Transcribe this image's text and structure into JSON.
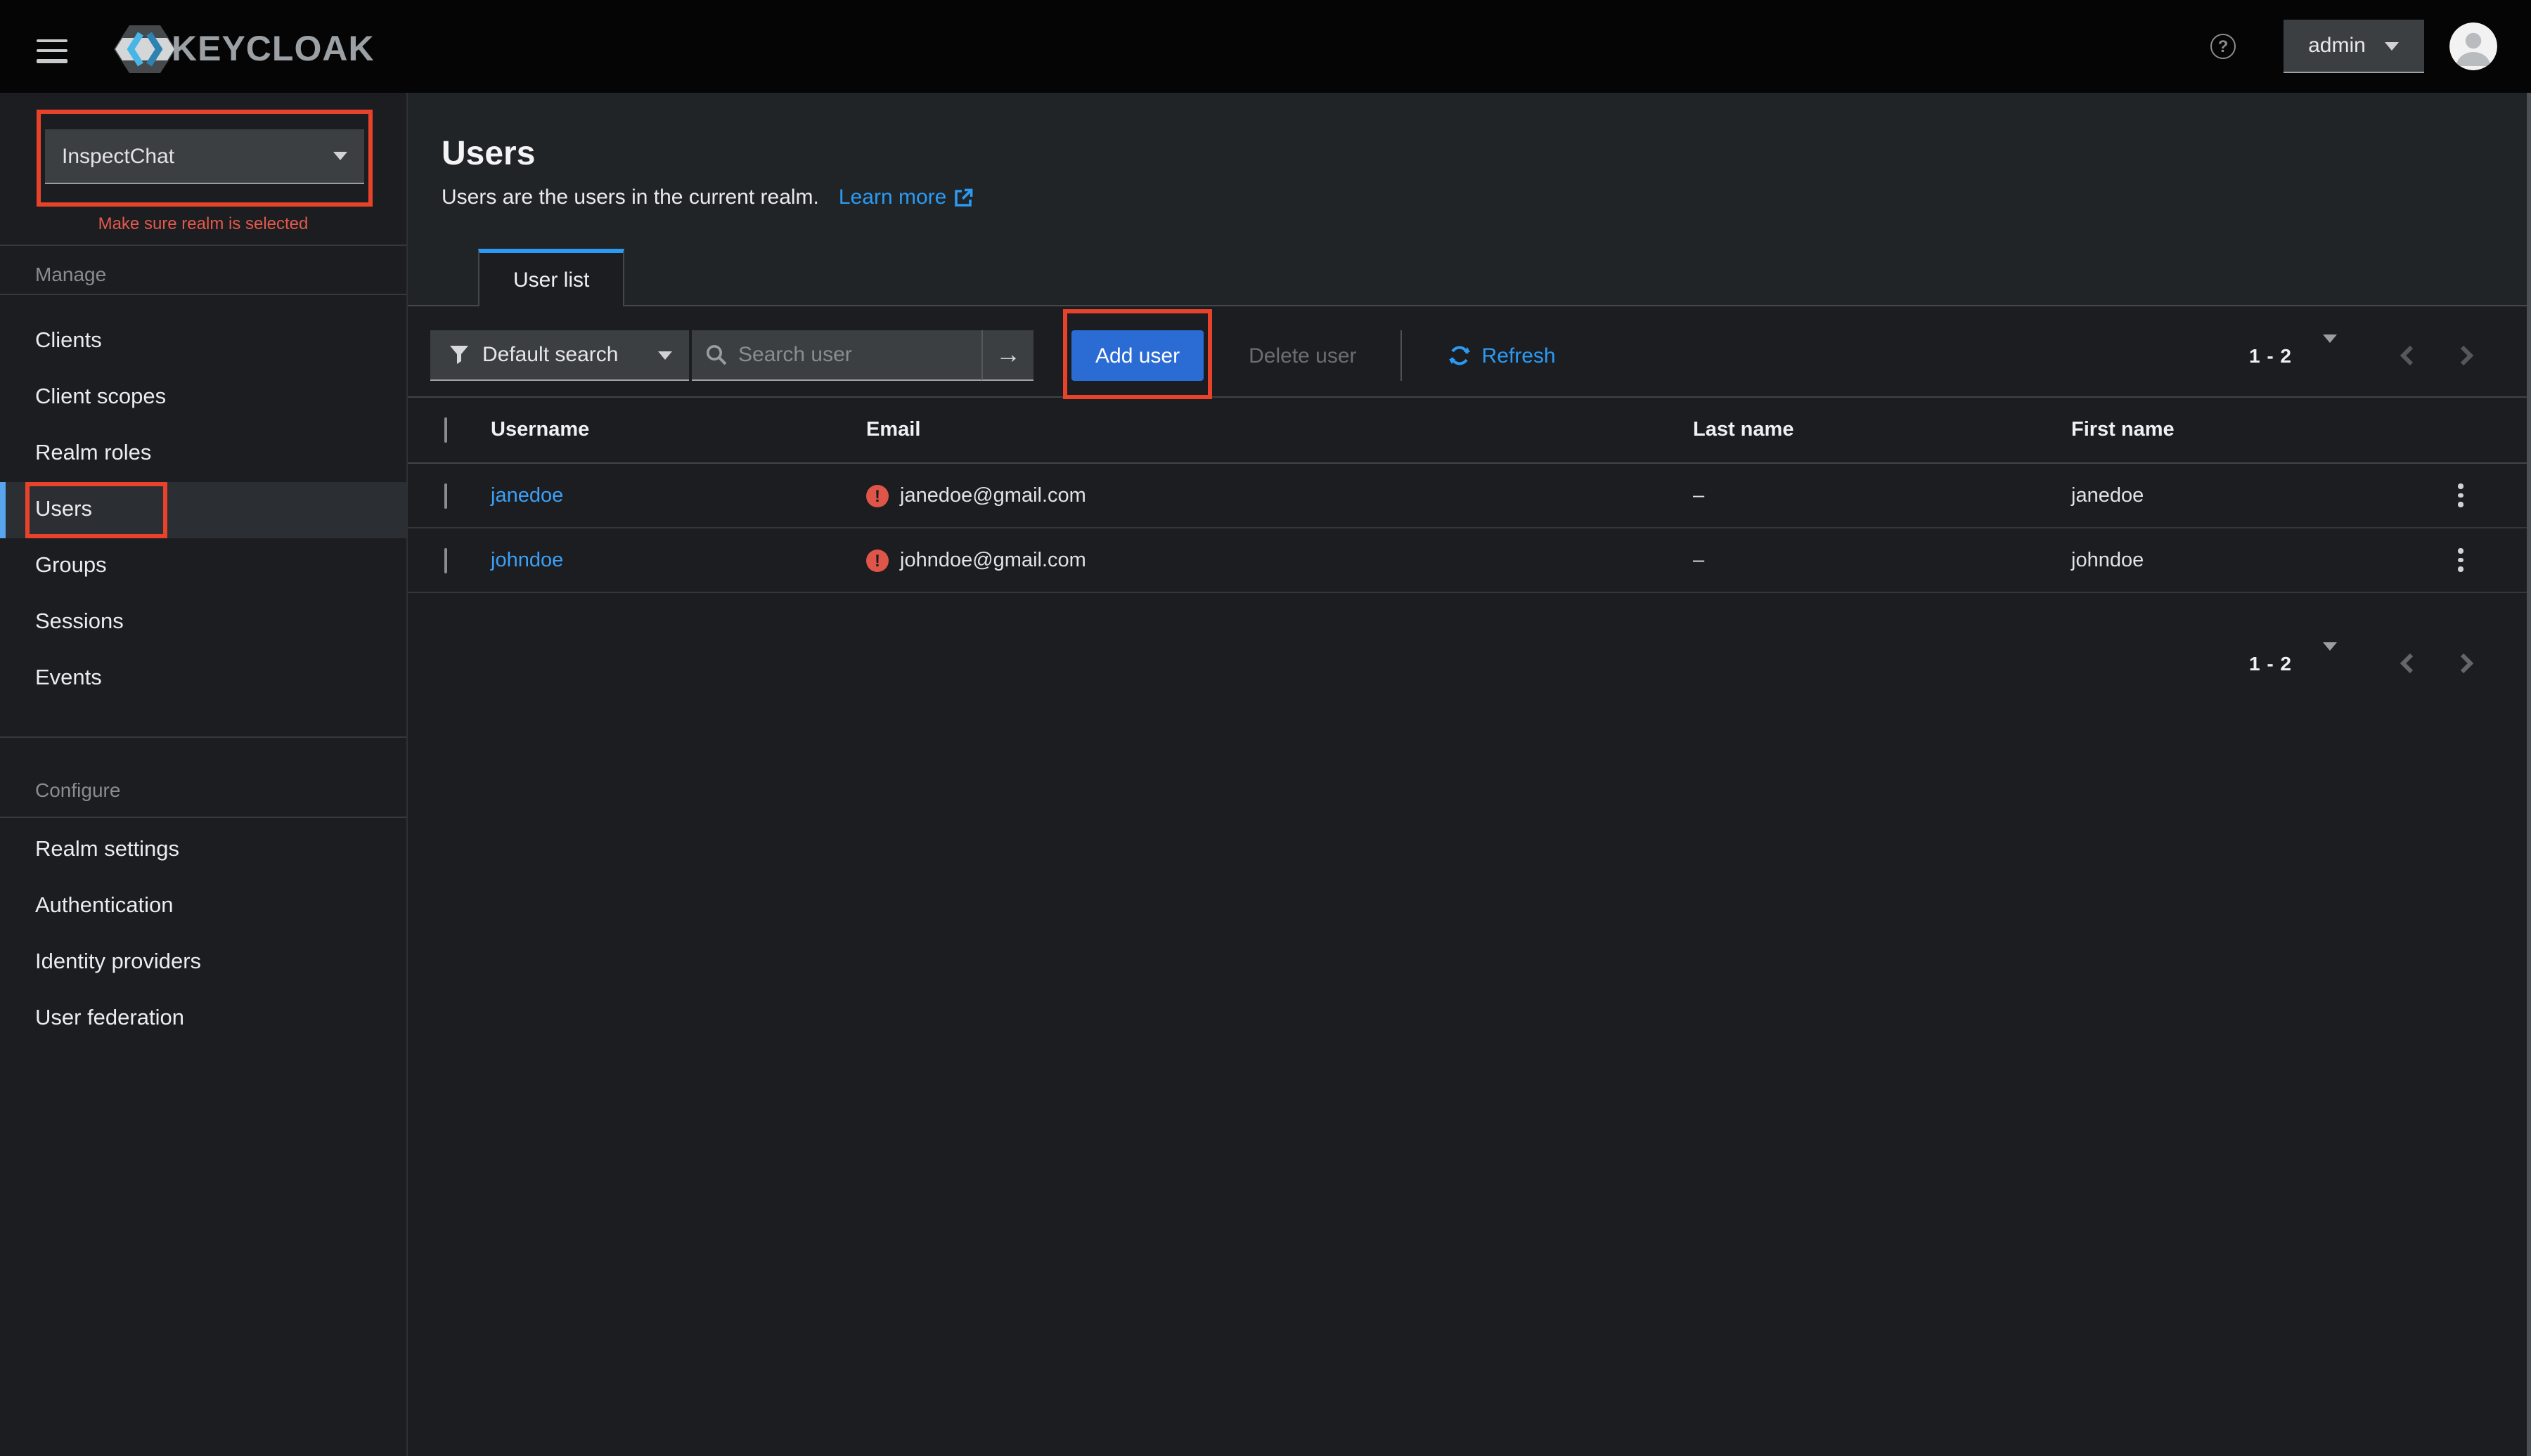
{
  "masthead": {
    "brand": "KEYCLOAK",
    "user_menu_label": "admin"
  },
  "sidebar": {
    "realm": {
      "selected": "InspectChat",
      "annotation": "Make sure realm is selected"
    },
    "sections": [
      {
        "label": "Manage",
        "items": [
          {
            "label": "Clients"
          },
          {
            "label": "Client scopes"
          },
          {
            "label": "Realm roles"
          },
          {
            "label": "Users"
          },
          {
            "label": "Groups"
          },
          {
            "label": "Sessions"
          },
          {
            "label": "Events"
          }
        ]
      },
      {
        "label": "Configure",
        "items": [
          {
            "label": "Realm settings"
          },
          {
            "label": "Authentication"
          },
          {
            "label": "Identity providers"
          },
          {
            "label": "User federation"
          }
        ]
      }
    ]
  },
  "page": {
    "title": "Users",
    "description": "Users are the users in the current realm.",
    "learn_more_label": "Learn more",
    "tab_label": "User list"
  },
  "toolbar": {
    "filter_label": "Default search",
    "search_placeholder": "Search user",
    "add_user_label": "Add user",
    "delete_user_label": "Delete user",
    "refresh_label": "Refresh",
    "pagination_label": "1 - 2"
  },
  "table": {
    "headers": [
      "Username",
      "Email",
      "Last name",
      "First name"
    ],
    "rows": [
      {
        "username": "janedoe",
        "email": "janedoe@gmail.com",
        "last_name": "–",
        "first_name": "janedoe"
      },
      {
        "username": "johndoe",
        "email": "johndoe@gmail.com",
        "last_name": "–",
        "first_name": "johndoe"
      }
    ]
  },
  "pagination_bottom_label": "1 - 2",
  "colors": {
    "annotation_red": "#e8432a",
    "link_blue": "#2b9af3",
    "primary_button_blue": "#2b6cd4",
    "danger_badge_red": "#e0554a",
    "active_tab_blue": "#2b9af3",
    "masthead_black": "#050505",
    "background_dark": "#1b1d21",
    "input_dark": "#3c3f42"
  }
}
